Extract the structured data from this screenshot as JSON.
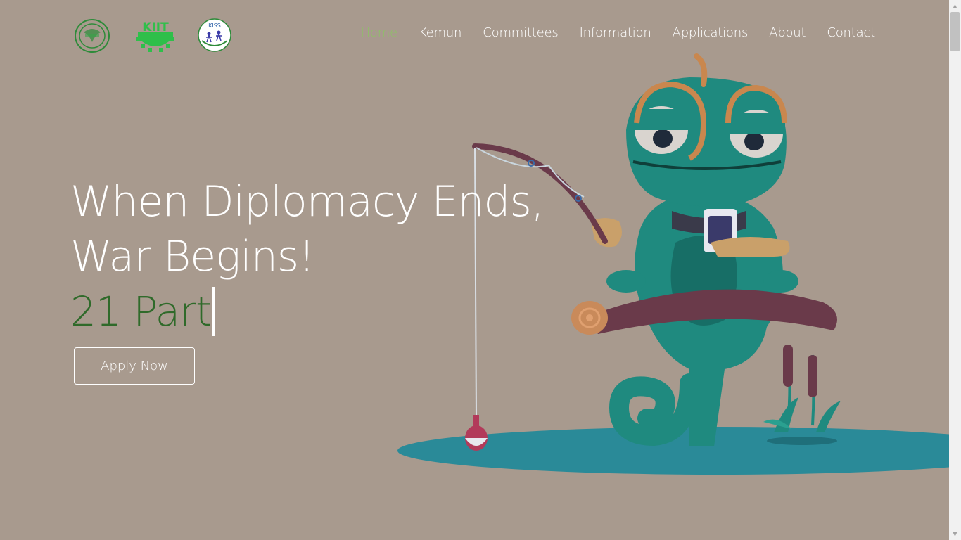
{
  "nav": {
    "items": [
      {
        "label": "Home",
        "active": true
      },
      {
        "label": "Kemun",
        "active": false
      },
      {
        "label": "Committees",
        "active": false
      },
      {
        "label": "Information",
        "active": false
      },
      {
        "label": "Applications",
        "active": false
      },
      {
        "label": "About",
        "active": false
      },
      {
        "label": "Contact",
        "active": false
      }
    ],
    "active_color": "#8fbf69"
  },
  "logos": {
    "kiit": "KIIT",
    "kiss": "KISS"
  },
  "hero": {
    "line1": "When Diplomacy Ends,",
    "line2": "War Begins!",
    "typed": "21 Part",
    "apply_label": "Apply Now"
  },
  "colors": {
    "background": "#a89a8e",
    "typed_text": "#2f6a2a",
    "chameleon": "#1f8a7f",
    "water": "#2a8a98"
  }
}
